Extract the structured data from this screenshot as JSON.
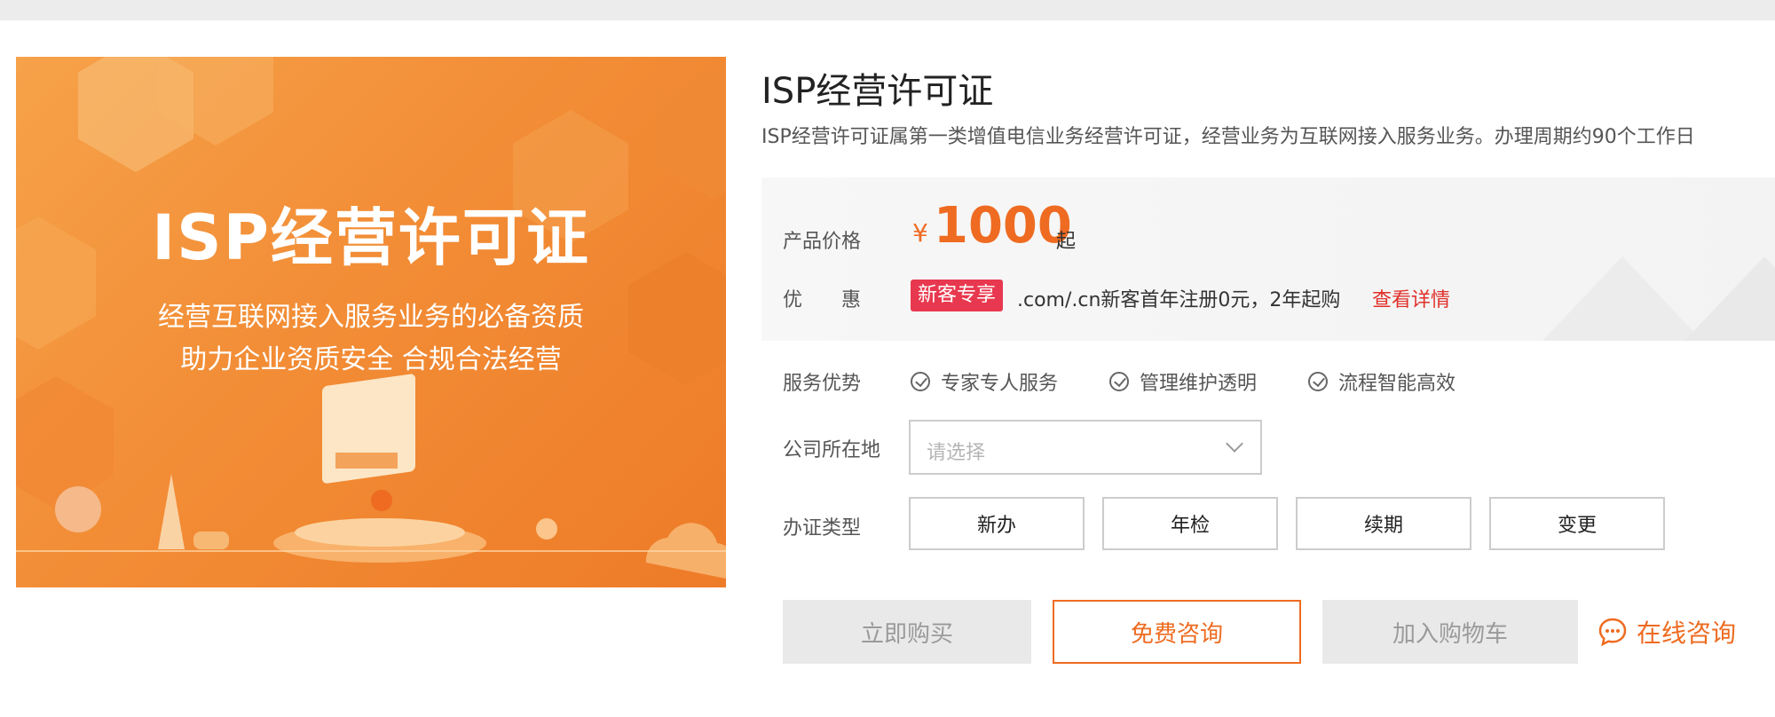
{
  "banner": {
    "title": "ISP经营许可证",
    "subtitle_line1": "经营互联网接入服务业务的必备资质",
    "subtitle_line2": "助力企业资质安全 合规合法经营"
  },
  "product": {
    "title": "ISP经营许可证",
    "description": "ISP经营许可证属第一类增值电信业务经营许可证，经营业务为互联网接入服务业务。办理周期约90个工作日"
  },
  "price": {
    "label": "产品价格",
    "currency": "¥",
    "amount": "1000",
    "suffix": "起"
  },
  "promotion": {
    "label": "优　　惠",
    "badge": "新客专享",
    "text": ".com/.cn新客首年注册0元，2年起购",
    "link": "查看详情"
  },
  "advantages": {
    "label": "服务优势",
    "items": [
      "专家专人服务",
      "管理维护透明",
      "流程智能高效"
    ]
  },
  "location": {
    "label": "公司所在地",
    "placeholder": "请选择"
  },
  "license_type": {
    "label": "办证类型",
    "options": [
      "新办",
      "年检",
      "续期",
      "变更"
    ]
  },
  "actions": {
    "buy": "立即购买",
    "consult": "免费咨询",
    "cart": "加入购物车",
    "online": "在线咨询"
  },
  "colors": {
    "accent": "#ee6b21",
    "badge": "#e8384f",
    "link": "#e0302a"
  }
}
